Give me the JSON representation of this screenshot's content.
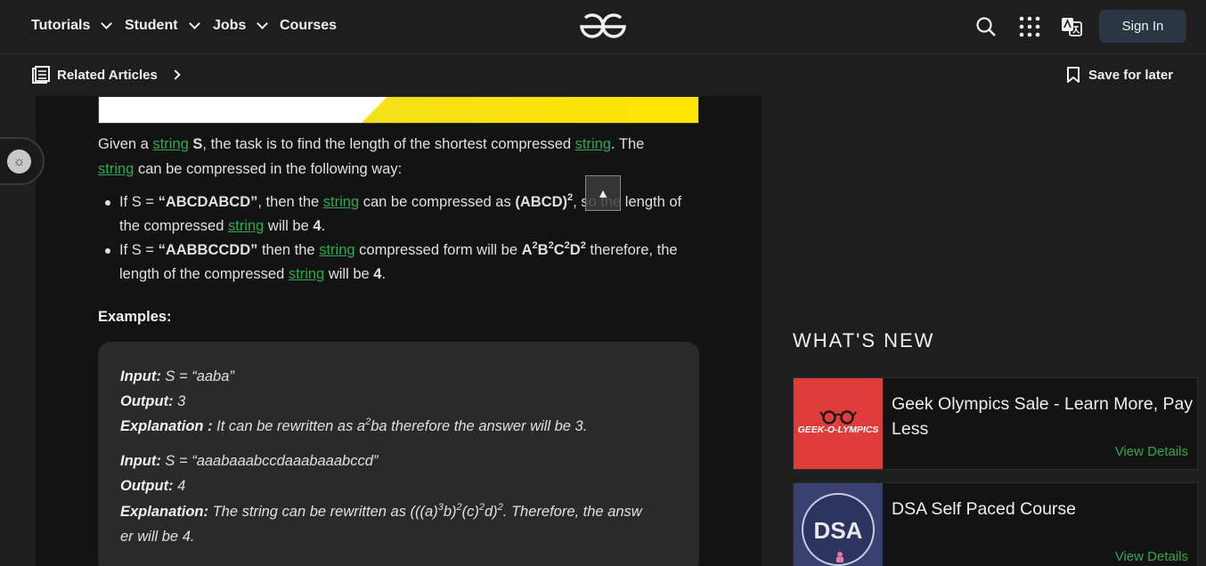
{
  "nav": {
    "items": [
      "Tutorials",
      "Student",
      "Jobs",
      "Courses"
    ],
    "signin_label": "Sign In"
  },
  "subnav": {
    "related_label": "Related Articles",
    "save_label": "Save for later"
  },
  "article": {
    "intro_1": "Given a ",
    "intro_link_1": "string",
    "intro_bold": " S",
    "intro_2": ", the task is to find the length of the shortest compressed ",
    "intro_link_2": "string",
    "intro_3": ". The",
    "intro_link_3": "string",
    "intro_4": " can be compressed in the following way:",
    "bullet1": {
      "a": "If S = ",
      "b": "“ABCDABCD”",
      "c": ", then the ",
      "link": "string",
      "d": " can be compressed as ",
      "e": "(ABCD)",
      "sup": "2",
      "f": ", so the length of",
      "g": "the compressed ",
      "link2": "string",
      "h": " will be ",
      "val": "4",
      "end": "."
    },
    "bullet2": {
      "a": "If S = ",
      "b": "“AABBCCDD”",
      "c": " then the ",
      "link": "string",
      "d": " compressed form will be ",
      "form": [
        "A",
        "B",
        "C",
        "D"
      ],
      "sup": "2",
      "e": " therefore, the",
      "f": "length of the compressed ",
      "link2": "string",
      "g": " will be ",
      "val": "4",
      "end": "."
    },
    "examples_heading": "Examples:",
    "ex1": {
      "input_label": "Input:",
      "input_val": " S = “aaba”",
      "output_label": "Output:",
      "output_val": " 3",
      "expl_label": "Explanation :",
      "expl_a": " It can be rewritten as a",
      "expl_sup": "2",
      "expl_b": "ba therefore the answer will be 3."
    },
    "ex2": {
      "input_label": "Input:",
      "input_val": " S = “aaabaaabccdaaabaaabccd”",
      "output_label": "Output:",
      "output_val": " 4",
      "expl_label": "Explanation:",
      "expl_a": " The string can be rewritten as (((a)",
      "s1": "3",
      "expl_b": "b)",
      "s2": "2",
      "expl_c": "(c)",
      "s3": "2",
      "expl_d": "d)",
      "s4": "2",
      "expl_e": ". Therefore, the answ",
      "expl_f": "er will be 4."
    }
  },
  "sidebar": {
    "whats_new": "WHAT'S NEW",
    "cards": [
      {
        "title": "Geek Olympics Sale - Learn More, Pay Less",
        "link": "View Details",
        "image_text": "GEEK-O-LYMPICS"
      },
      {
        "title": "DSA Self Paced Course",
        "link": "View Details",
        "image_text": "DSA"
      }
    ]
  },
  "scroll_top_glyph": "▲",
  "colors": {
    "link": "#2fa84f",
    "accent_red": "#e03c3c",
    "signin_bg": "#2a3642"
  }
}
